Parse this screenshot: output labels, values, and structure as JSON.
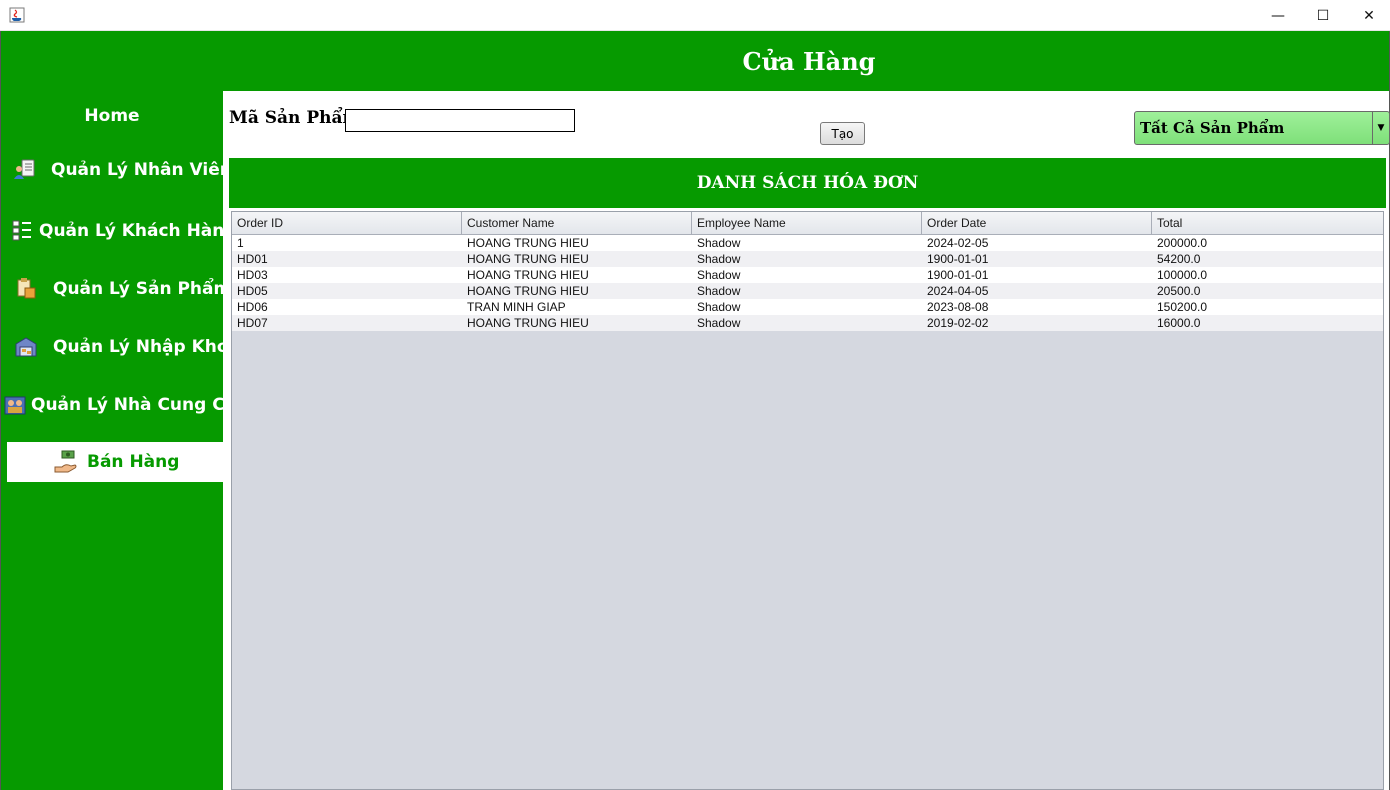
{
  "window": {
    "title": "",
    "controls": {
      "minimize": "—",
      "maximize": "☐",
      "close": "✕"
    }
  },
  "header": {
    "title": "Cửa Hàng"
  },
  "sidebar": {
    "items": [
      {
        "label": "Home",
        "icon": "home",
        "active": false
      },
      {
        "label": "Quản Lý Nhân Viên",
        "icon": "employee-icon",
        "active": false
      },
      {
        "label": "Quản Lý Khách Hàng",
        "icon": "customer-icon",
        "active": false
      },
      {
        "label": "Quản Lý Sản Phẩm",
        "icon": "product-icon",
        "active": false
      },
      {
        "label": "Quản Lý Nhập Kho",
        "icon": "warehouse-icon",
        "active": false
      },
      {
        "label": "Quản Lý Nhà Cung Cấp",
        "icon": "supplier-icon",
        "active": false
      },
      {
        "label": "Bán Hàng",
        "icon": "sales-icon",
        "active": true
      }
    ]
  },
  "toolbar": {
    "code_label": "Mã Sản Phẩm",
    "code_value": "",
    "create_label": "Tạo",
    "filter_selected": "Tất Cả Sản Phẩm"
  },
  "list": {
    "title": "DANH SÁCH HÓA ĐƠN",
    "columns": [
      "Order ID",
      "Customer Name",
      "Employee Name",
      "Order Date",
      "Total"
    ],
    "rows": [
      [
        "1",
        "HOANG TRUNG HIEU",
        "Shadow",
        "2024-02-05",
        "200000.0"
      ],
      [
        "HD01",
        "HOANG TRUNG HIEU",
        "Shadow",
        "1900-01-01",
        "54200.0"
      ],
      [
        "HD03",
        "HOANG TRUNG HIEU",
        "Shadow",
        "1900-01-01",
        "100000.0"
      ],
      [
        "HD05",
        "HOANG TRUNG HIEU",
        "Shadow",
        "2024-04-05",
        "20500.0"
      ],
      [
        "HD06",
        "TRAN MINH GIAP",
        "Shadow",
        "2023-08-08",
        "150200.0"
      ],
      [
        "HD07",
        "HOANG TRUNG HIEU",
        "Shadow",
        "2019-02-02",
        "16000.0"
      ]
    ]
  },
  "colors": {
    "brand_green": "#069a00",
    "combo_green": "#8ee889",
    "table_bg": "#d5d8e0"
  }
}
